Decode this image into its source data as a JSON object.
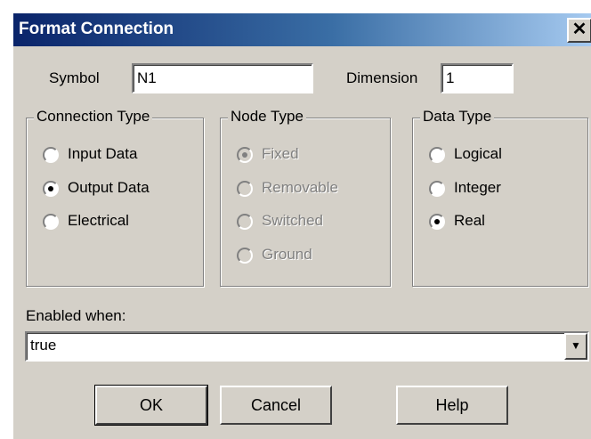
{
  "window": {
    "title": "Format Connection",
    "close_glyph": "✕"
  },
  "symbol": {
    "label": "Symbol",
    "value": "N1"
  },
  "dimension": {
    "label": "Dimension",
    "value": "1"
  },
  "connection_type": {
    "title": "Connection Type",
    "options": [
      {
        "label": "Input Data",
        "selected": false
      },
      {
        "label": "Output Data",
        "selected": true
      },
      {
        "label": "Electrical",
        "selected": false
      }
    ]
  },
  "node_type": {
    "title": "Node Type",
    "enabled": false,
    "options": [
      {
        "label": "Fixed",
        "selected": true
      },
      {
        "label": "Removable",
        "selected": false
      },
      {
        "label": "Switched",
        "selected": false
      },
      {
        "label": "Ground",
        "selected": false
      }
    ]
  },
  "data_type": {
    "title": "Data Type",
    "options": [
      {
        "label": "Logical",
        "selected": false
      },
      {
        "label": "Integer",
        "selected": false
      },
      {
        "label": "Real",
        "selected": true
      }
    ]
  },
  "enabled_when": {
    "label": "Enabled when:",
    "value": "true",
    "arrow_glyph": "▼"
  },
  "buttons": {
    "ok": "OK",
    "cancel": "Cancel",
    "help": "Help"
  },
  "colors": {
    "face": "#d4d0c8",
    "title_start": "#0a246a",
    "title_end": "#a6caf0",
    "disabled_text": "#808080"
  }
}
